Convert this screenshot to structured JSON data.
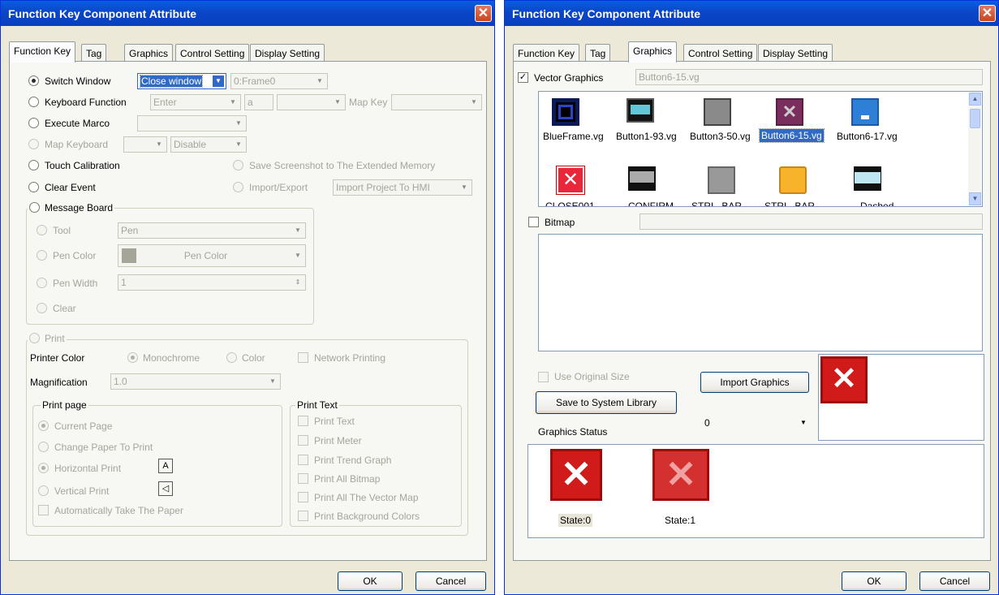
{
  "left": {
    "title": "Function Key Component Attribute",
    "tabs": [
      "Function Key",
      "Tag",
      "Graphics",
      "Control Setting",
      "Display Setting"
    ],
    "switch_window": {
      "label": "Switch Window",
      "value": "Close window",
      "frame": "0:Frame0"
    },
    "keyboard_function": {
      "label": "Keyboard Function",
      "value": "Enter",
      "char": "a",
      "map_key": "Map Key"
    },
    "execute_marco": "Execute Marco",
    "map_keyboard": {
      "label": "Map Keyboard",
      "mode": "Disable"
    },
    "touch_calibration": "Touch Calibration",
    "save_screenshot": "Save Screenshot to The Extended Memory",
    "clear_event": "Clear Event",
    "import_export": {
      "label": "Import/Export",
      "value": "Import Project To HMI"
    },
    "message_board": {
      "label": "Message Board",
      "tool": "Tool",
      "tool_value": "Pen",
      "pen_color": "Pen Color",
      "pen_color_value": "Pen Color",
      "pen_width": "Pen Width",
      "pen_width_value": "1",
      "clear": "Clear"
    },
    "print": {
      "label": "Print",
      "printer_color": "Printer Color",
      "monochrome": "Monochrome",
      "color": "Color",
      "network_printing": "Network Printing",
      "magnification": "Magnification",
      "magnification_value": "1.0"
    },
    "print_page": {
      "label": "Print page",
      "current": "Current Page",
      "change_paper": "Change Paper To Print",
      "horizontal": "Horizontal Print",
      "vertical": "Vertical Print",
      "auto_take": "Automatically Take The Paper"
    },
    "print_text": {
      "label": "Print Text",
      "items": [
        "Print Text",
        "Print Meter",
        "Print Trend Graph",
        "Print All Bitmap",
        "Print All The Vector Map",
        "Print Background Colors"
      ]
    },
    "ok": "OK",
    "cancel": "Cancel"
  },
  "right": {
    "title": "Function Key Component Attribute",
    "tabs": [
      "Function Key",
      "Tag",
      "Graphics",
      "Control Setting",
      "Display Setting"
    ],
    "vector_graphics": {
      "label": "Vector Graphics",
      "file": "Button6-15.vg"
    },
    "vg_items": [
      "BlueFrame.vg",
      "Button1-93.vg",
      "Button3-50.vg",
      "Button6-15.vg",
      "Button6-17.vg"
    ],
    "vg_row2": [
      "CLOSE001",
      "CONFIRM",
      "STRL_BAR",
      "STRL_BAR",
      "Dashed"
    ],
    "bitmap": "Bitmap",
    "use_original_size": "Use Original Size",
    "import_graphics": "Import Graphics",
    "save_system_library": "Save to System Library",
    "graphics_status": "Graphics Status",
    "status_value": "0",
    "states": [
      "State:0",
      "State:1"
    ],
    "ok": "OK",
    "cancel": "Cancel"
  }
}
